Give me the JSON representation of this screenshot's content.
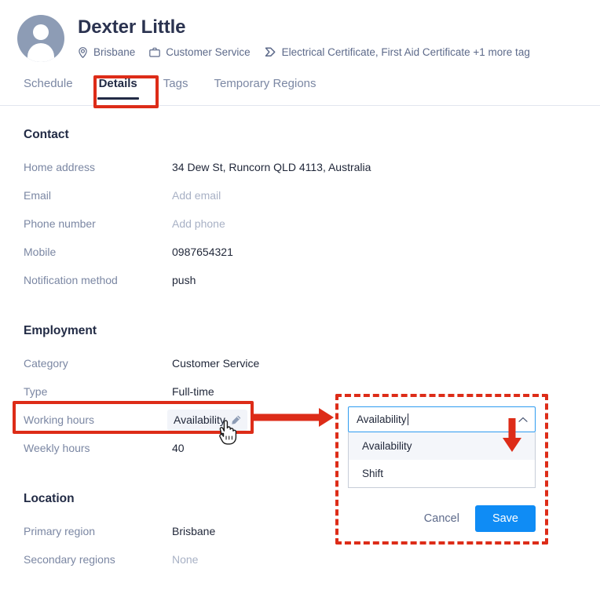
{
  "profile": {
    "name": "Dexter Little",
    "avatar_icon": "person-avatar-icon",
    "meta": [
      {
        "icon": "location-pin-icon",
        "text": "Brisbane"
      },
      {
        "icon": "briefcase-icon",
        "text": "Customer Service"
      },
      {
        "icon": "tag-icon",
        "text": "Electrical Certificate, First Aid Certificate +1 more tag"
      }
    ]
  },
  "tabs": [
    {
      "label": "Schedule",
      "active": false
    },
    {
      "label": "Details",
      "active": true
    },
    {
      "label": "Tags",
      "active": false
    },
    {
      "label": "Temporary Regions",
      "active": false
    }
  ],
  "sections": {
    "contact": {
      "title": "Contact",
      "rows": [
        {
          "label": "Home address",
          "value": "34 Dew St, Runcorn QLD 4113, Australia",
          "muted": false
        },
        {
          "label": "Email",
          "value": "Add email",
          "muted": true
        },
        {
          "label": "Phone number",
          "value": "Add phone",
          "muted": true
        },
        {
          "label": "Mobile",
          "value": "0987654321",
          "muted": false
        },
        {
          "label": "Notification method",
          "value": "push",
          "muted": false
        }
      ]
    },
    "employment": {
      "title": "Employment",
      "rows": [
        {
          "label": "Category",
          "value": "Customer Service",
          "muted": false
        },
        {
          "label": "Type",
          "value": "Full-time",
          "muted": false
        },
        {
          "label": "Working hours",
          "value": "Availability",
          "muted": false,
          "edit_icon": "pencil-icon"
        },
        {
          "label": "Weekly hours",
          "value": "40",
          "muted": false
        }
      ]
    },
    "location": {
      "title": "Location",
      "rows": [
        {
          "label": "Primary region",
          "value": "Brisbane",
          "muted": false
        },
        {
          "label": "Secondary regions",
          "value": "None",
          "muted": true
        }
      ]
    }
  },
  "editor": {
    "input_value": "Availability",
    "chevron_icon": "chevron-up-icon",
    "options": [
      {
        "label": "Availability",
        "highlighted": true
      },
      {
        "label": "Shift",
        "highlighted": false
      }
    ],
    "cancel_label": "Cancel",
    "save_label": "Save"
  },
  "annotations": {
    "color": "#dd2c18",
    "highlight_tab": "Details",
    "highlight_row": "Working hours",
    "arrow_right_icon": "red-arrow-right-icon",
    "arrow_down_icon": "red-arrow-down-icon",
    "cursor_icon": "pointing-hand-cursor-icon"
  },
  "colors": {
    "accent_blue": "#0f8cf5",
    "focus_blue": "#2e9bf0",
    "annotation_red": "#dd2c18",
    "text_dark": "#222b45",
    "text_muted": "#7b87a3"
  }
}
